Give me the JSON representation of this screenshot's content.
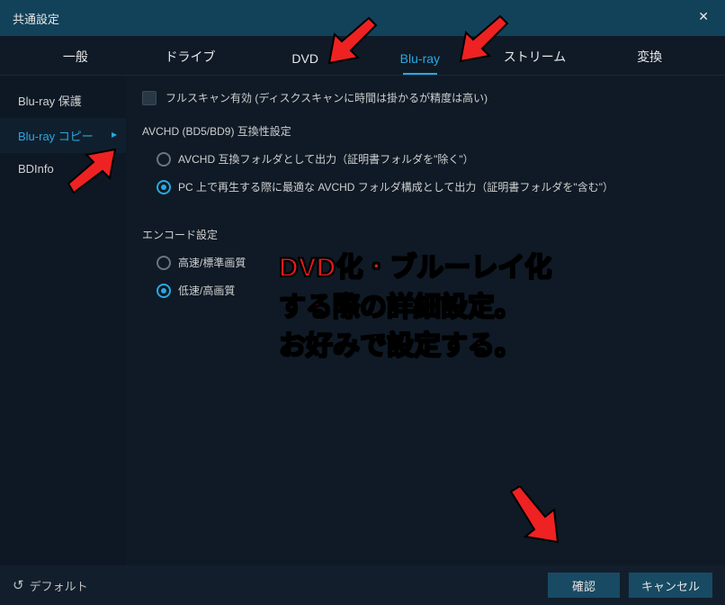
{
  "window": {
    "title": "共通設定"
  },
  "tabs": [
    "一般",
    "ドライブ",
    "DVD",
    "Blu-ray",
    "ストリーム",
    "変換"
  ],
  "active_tab": 3,
  "sidebar": {
    "items": [
      "Blu-ray 保護",
      "Blu-ray コピー",
      "BDInfo"
    ],
    "active": 1
  },
  "content": {
    "fullscan": {
      "checked": false,
      "label": "フルスキャン有効 (ディスクスキャンに時間は掛かるが精度は高い)"
    },
    "avchd": {
      "title": "AVCHD (BD5/BD9) 互換性設定",
      "options": [
        "AVCHD 互換フォルダとして出力（証明書フォルダを\"除く\"）",
        "PC 上で再生する際に最適な AVCHD フォルダ構成として出力（証明書フォルダを\"含む\"）"
      ],
      "selected": 1
    },
    "encode": {
      "title": "エンコード設定",
      "options": [
        "高速/標準画質",
        "低速/高画質"
      ],
      "selected": 1
    }
  },
  "footer": {
    "default": "デフォルト",
    "ok": "確認",
    "cancel": "キャンセル"
  },
  "annotation": {
    "lines": "DVD化・ブルーレイ化\nする際の詳細設定。\nお好みで設定する。"
  }
}
